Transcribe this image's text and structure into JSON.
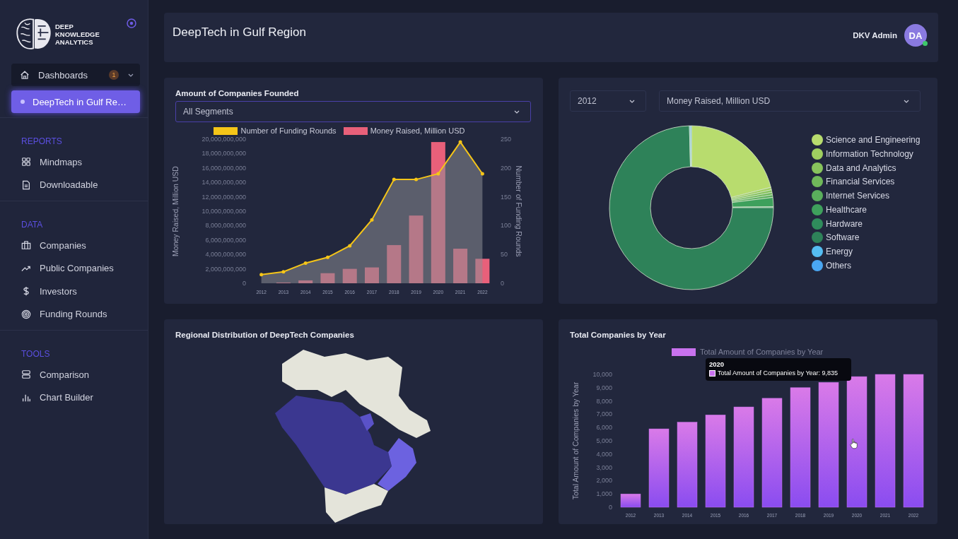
{
  "sidebar": {
    "logo_lines": [
      "DEEP",
      "KNOWLEDGE",
      "ANALYTICS"
    ],
    "menu": {
      "label": "Dashboards",
      "badge": "1",
      "expanded": true,
      "children": [
        {
          "label": "DeepTech in Gulf Re…",
          "selected": true
        }
      ]
    },
    "sections": [
      {
        "title": "REPORTS",
        "items": [
          {
            "label": "Mindmaps",
            "selected": false
          },
          {
            "label": "Downloadable",
            "selected": false
          }
        ]
      },
      {
        "title": "DATA",
        "items": [
          {
            "label": "Companies",
            "selected": false
          },
          {
            "label": "Public Companies",
            "selected": false
          },
          {
            "label": "Investors",
            "selected": false
          },
          {
            "label": "Funding Rounds",
            "selected": false
          }
        ]
      },
      {
        "title": "TOOLS",
        "items": [
          {
            "label": "Comparison",
            "selected": false
          },
          {
            "label": "Chart Builder",
            "selected": false
          }
        ]
      }
    ]
  },
  "header": {
    "title": "DeepTech in Gulf Region",
    "user": "DKV Admin",
    "avatar": "DA",
    "online": true
  },
  "funding_card": {
    "title": "Amount of Companies Founded",
    "segment_select": "All Segments",
    "rounds_chart": {
      "chart_data": {
        "type": "area",
        "categories": [
          "2012",
          "2013",
          "2014",
          "2015",
          "2016",
          "2017",
          "2018",
          "2019",
          "2020",
          "2021",
          "2022"
        ],
        "ylabel": "Number of Funding Rounds",
        "ylim": [
          0,
          250
        ],
        "yticks": [
          0,
          50,
          100,
          150,
          200,
          250
        ],
        "series": [
          {
            "name": "Number of Funding Rounds",
            "color": "#f5c518",
            "values": [
              15,
              20,
              35,
              45,
              65,
              110,
              180,
              180,
              190,
              245,
              190
            ]
          }
        ]
      }
    },
    "money_chart": {
      "chart_data": {
        "type": "bar",
        "ylabel": "Money Raised, Million USD",
        "ylim": [
          0,
          20000000000
        ],
        "yticks": [
          {
            "value": 0,
            "label": "0"
          },
          {
            "value": 2000000000,
            "label": "2,000,000,000"
          },
          {
            "value": 4000000000,
            "label": "4,000,000,000"
          },
          {
            "value": 6000000000,
            "label": "6,000,000,000"
          },
          {
            "value": 8000000000,
            "label": "8,000,000,000"
          },
          {
            "value": 10000000000,
            "label": "10,000,000,000"
          },
          {
            "value": 12000000000,
            "label": "12,000,000,000"
          },
          {
            "value": 14000000000,
            "label": "14,000,000,000"
          },
          {
            "value": 16000000000,
            "label": "16,000,000,000"
          },
          {
            "value": 18000000000,
            "label": "18,000,000,000"
          },
          {
            "value": 20000000000,
            "label": "20,000,000,000"
          }
        ],
        "series": [
          {
            "name": "Money Raised, Million USD",
            "color": "#e8607a",
            "values": [
              0,
              100000000,
              400000000,
              1400000000,
              2000000000,
              2200000000,
              5300000000,
              9400000000,
              19600000000,
              4800000000,
              3400000000
            ]
          }
        ]
      }
    }
  },
  "sector_card": {
    "year_select": "2012",
    "metric_select": "Money Raised, Million USD",
    "legend": [
      {
        "label": "Science and Engineering",
        "color": "#b8dc6e"
      },
      {
        "label": "Information Technology",
        "color": "#a0cf60"
      },
      {
        "label": "Data and Analytics",
        "color": "#88c45c"
      },
      {
        "label": "Financial Services",
        "color": "#70b95a"
      },
      {
        "label": "Internet Services",
        "color": "#5aae5c"
      },
      {
        "label": "Healthcare",
        "color": "#3ea05c"
      },
      {
        "label": "Hardware",
        "color": "#2f8c5c"
      },
      {
        "label": "Software",
        "color": "#2e8259"
      },
      {
        "label": "Energy",
        "color": "#55bdf2"
      },
      {
        "label": "Others",
        "color": "#4aa6f2"
      }
    ]
  },
  "map_card": {
    "title": "Regional Distribution of DeepTech Companies"
  },
  "companies_card": {
    "title": "Total Companies by Year",
    "chart_data": {
      "type": "bar",
      "categories": [
        "2012",
        "2013",
        "2014",
        "2015",
        "2016",
        "2017",
        "2018",
        "2019",
        "2020",
        "2021",
        "2022"
      ],
      "ylabel": "Total Amount of Companies by Year",
      "ylim": [
        0,
        10000
      ],
      "yticks": [
        {
          "value": 0,
          "label": "0"
        },
        {
          "value": 1000,
          "label": "1,000"
        },
        {
          "value": 2000,
          "label": "2,000"
        },
        {
          "value": 3000,
          "label": "3,000"
        },
        {
          "value": 4000,
          "label": "4,000"
        },
        {
          "value": 5000,
          "label": "5,000"
        },
        {
          "value": 6000,
          "label": "6,000"
        },
        {
          "value": 7000,
          "label": "7,000"
        },
        {
          "value": 8000,
          "label": "8,000"
        },
        {
          "value": 9000,
          "label": "9,000"
        },
        {
          "value": 10000,
          "label": "10,000"
        }
      ],
      "series": [
        {
          "name": "Total Amount of Companies by Year",
          "color": "#c872ee",
          "values": [
            1000,
            5900,
            6400,
            6950,
            7550,
            8200,
            9000,
            9400,
            9835,
            10000,
            10000
          ]
        }
      ]
    },
    "tooltip": {
      "title": "2020",
      "text": "Total Amount of Companies by Year: 9,835"
    }
  }
}
